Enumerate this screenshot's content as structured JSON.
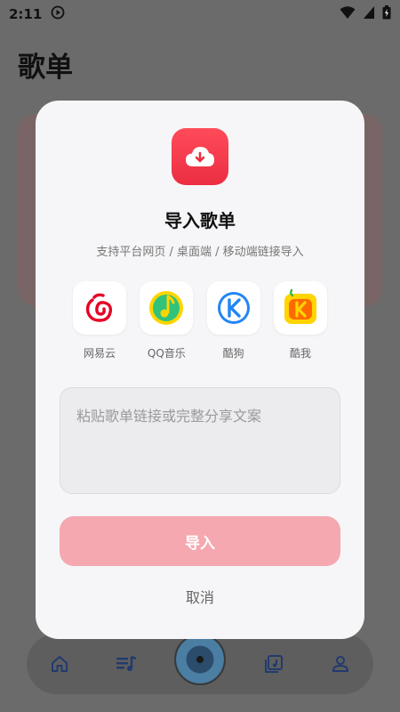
{
  "status_bar": {
    "time": "2:11"
  },
  "page": {
    "title": "歌单"
  },
  "dialog": {
    "title": "导入歌单",
    "subtitle": "支持平台网页 / 桌面端 / 移动端链接导入",
    "platforms": [
      {
        "label": "网易云",
        "icon": "netease-icon",
        "color": "#e60026"
      },
      {
        "label": "QQ音乐",
        "icon": "qqmusic-icon",
        "color": "#31c27c"
      },
      {
        "label": "酷狗",
        "icon": "kugou-icon",
        "color": "#2186f5"
      },
      {
        "label": "酷我",
        "icon": "kuwo-icon",
        "color": "#ffd400"
      }
    ],
    "input": {
      "placeholder": "粘贴歌单链接或完整分享文案",
      "value": ""
    },
    "import_label": "导入",
    "cancel_label": "取消"
  },
  "bottom_nav": {
    "items": [
      "home-icon",
      "playlist-icon",
      "now-playing-disc",
      "library-icon",
      "profile-icon"
    ]
  },
  "colors": {
    "accent": "#ec2d42",
    "import_button_disabled": "#f5a8b0",
    "dialog_bg": "#f6f6f8",
    "scrim": "#6b6b6b"
  }
}
